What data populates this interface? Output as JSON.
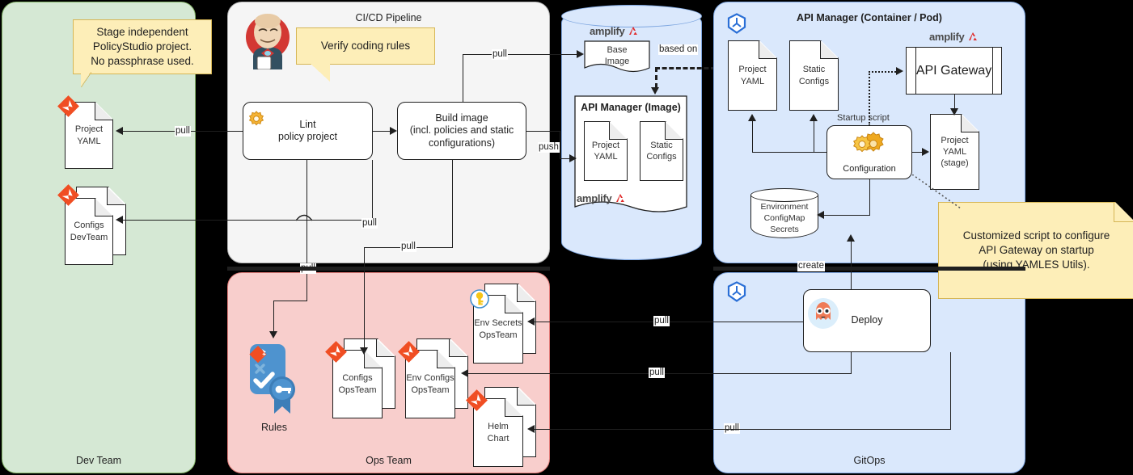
{
  "lanes": {
    "dev_team": "Dev Team",
    "cicd": "CI/CD Pipeline",
    "ops_team": "Ops Team",
    "gitops": "GitOps",
    "api_manager_pod": "API Manager (Container / Pod)"
  },
  "callouts": {
    "dev_note": "Stage independent PolicyStudio project. No passphrase used.",
    "dev_note_lines": [
      "Stage independent",
      "PolicyStudio project.",
      "No passphrase used."
    ],
    "jenkins_note": "Verify coding rules",
    "startup_note_lines": [
      "Customized script to configure",
      "API Gateway on startup",
      "(using YAMLES Utils)."
    ]
  },
  "dev_team": {
    "project_yaml": [
      "Project",
      "YAML"
    ],
    "configs_devteam": [
      "Configs",
      "DevTeam"
    ]
  },
  "cicd": {
    "lint": [
      "Lint",
      "policy project"
    ],
    "build": [
      "Build image",
      "(incl. policies and static",
      "configurations)"
    ]
  },
  "image": {
    "base_image": [
      "Base",
      "Image"
    ],
    "api_manager_image_title": "API Manager (Image)",
    "project_yaml": [
      "Project",
      "YAML"
    ],
    "static_configs": [
      "Static",
      "Configs"
    ],
    "amplify_wordmark": "amplify",
    "based_on": "based on"
  },
  "pod": {
    "project_yaml": [
      "Project",
      "YAML"
    ],
    "static_configs": [
      "Static",
      "Configs"
    ],
    "api_gateway": "API Gateway",
    "startup_script": "Startup script",
    "configuration": "Configuration",
    "project_yaml_stage": [
      "Project",
      "YAML",
      "(stage)"
    ],
    "environment": [
      "Environment",
      "ConfigMap",
      "Secrets"
    ],
    "amplify_wordmark": "amplify"
  },
  "ops_team": {
    "rules": "Rules",
    "configs_opsteam": [
      "Configs",
      "OpsTeam"
    ],
    "env_configs_opsteam": [
      "Env Configs",
      "OpsTeam"
    ],
    "env_secrets_opsteam": [
      "Env Secrets",
      "OpsTeam"
    ],
    "helm_chart": [
      "Helm",
      "Chart"
    ]
  },
  "gitops": {
    "deploy": "Deploy"
  },
  "edges": {
    "pull_devteam_project": "pull",
    "pull_top": "pull",
    "push": "push",
    "pull_mid1": "pull",
    "pull_mid2": "pull",
    "pull_lint": "pull",
    "pull_gitops1": "pull",
    "pull_gitops2": "pull",
    "pull_gitops3": "pull",
    "create": "create"
  },
  "icons": {
    "jenkins": "jenkins-butler-icon",
    "gear": "gear-icon",
    "gears": "gears-icon",
    "rules_badge": "rules-certificate-icon",
    "key": "key-icon",
    "kubernetes": "kubernetes-icon",
    "argo": "argo-octopus-icon",
    "git": "git-file-icon",
    "amplify": "amplify-logo-icon"
  },
  "colors": {
    "green_lane": "#d5e8d4",
    "green_border": "#82b366",
    "grey_lane": "#f5f5f5",
    "pink_lane": "#f8cecc",
    "pink_border": "#e07a77",
    "blue_lane": "#dae8fc",
    "blue_border": "#7ea6e0",
    "note_yellow": "#fdeeb8",
    "note_border": "#d6b656",
    "accent_red": "#f04e23",
    "background": "#000000"
  }
}
